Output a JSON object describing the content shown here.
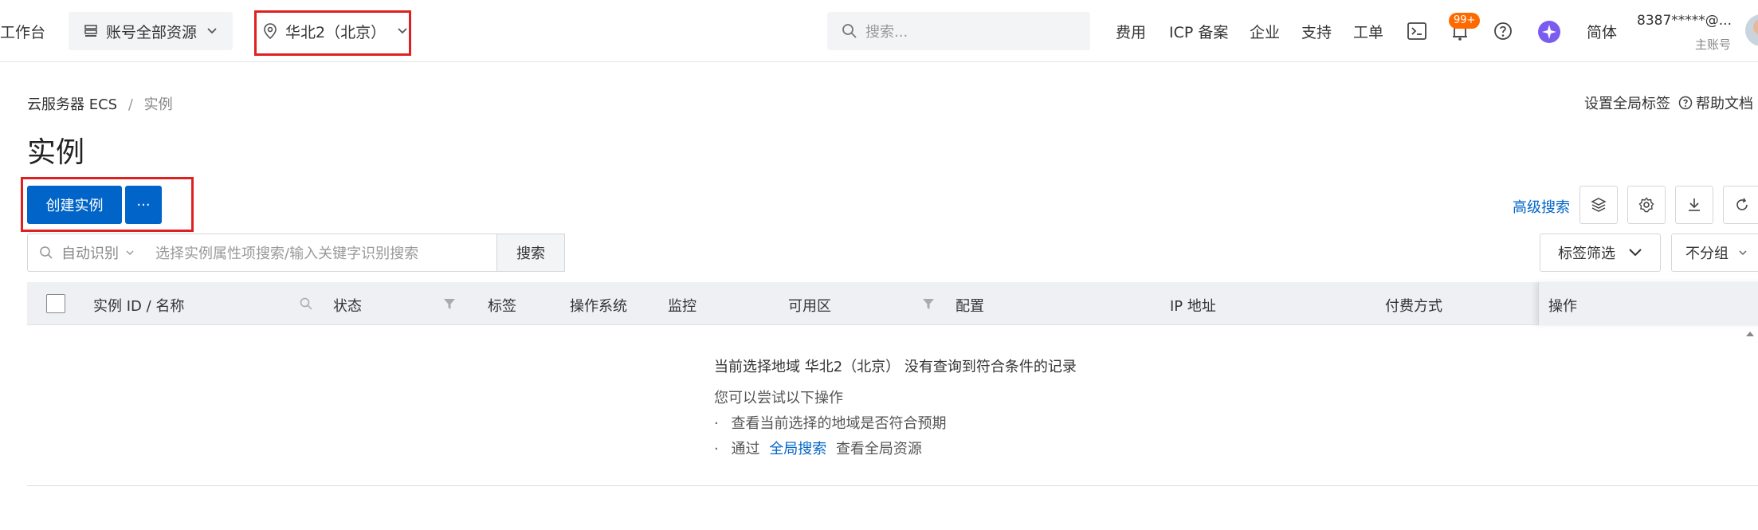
{
  "topbar": {
    "workbench": "工作台",
    "account_resources": "账号全部资源",
    "region": "华北2（北京）",
    "search_placeholder": "搜索...",
    "nav": {
      "fee": "费用",
      "icp": "ICP 备案",
      "enterprise": "企业",
      "support": "支持",
      "ticket": "工单",
      "lang": "简体"
    },
    "notification_badge": "99+",
    "account_id": "8387*****@...",
    "account_type": "主账号"
  },
  "breadcrumb": {
    "root": "云服务器 ECS",
    "sep": "/",
    "current": "实例"
  },
  "header_links": {
    "global_tags": "设置全局标签",
    "help_docs": "帮助文档"
  },
  "page_title": "实例",
  "actions": {
    "create": "创建实例",
    "more": "···",
    "advanced_search": "高级搜索"
  },
  "filter": {
    "auto_detect": "自动识别",
    "placeholder": "选择实例属性项搜索/输入关键字识别搜索",
    "search_button": "搜索",
    "tag_filter": "标签筛选",
    "group": "不分组"
  },
  "table": {
    "columns": [
      "实例 ID / 名称",
      "状态",
      "标签",
      "操作系统",
      "监控",
      "可用区",
      "配置",
      "IP 地址",
      "付费方式",
      "操作"
    ]
  },
  "empty_state": {
    "title": "当前选择地域 华北2（北京） 没有查询到符合条件的记录",
    "try": "您可以尝试以下操作",
    "item1": "查看当前选择的地域是否符合预期",
    "item2_prefix": "通过",
    "item2_link": "全局搜索",
    "item2_suffix": "查看全局资源",
    "bullet": "·"
  },
  "colors": {
    "primary": "#0064c8",
    "highlight": "#e02020",
    "badge": "#ff6a00"
  }
}
